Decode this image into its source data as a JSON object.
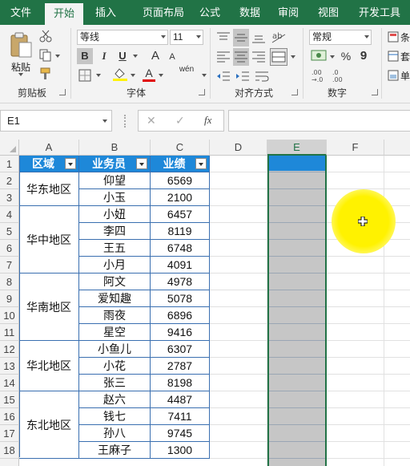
{
  "ribbon_tabs": [
    "文件",
    "开始",
    "插入",
    "页面布局",
    "公式",
    "数据",
    "审阅",
    "视图",
    "开发工具"
  ],
  "ribbon": {
    "paste_label": "粘贴",
    "font_name": "等线",
    "font_size": "11",
    "bold": "B",
    "italic": "I",
    "underline": "U",
    "grow_font": "A",
    "shrink_font": "A",
    "font_color": "A",
    "phonetic": "wén",
    "number_format": "常规",
    "percent": "%",
    "comma": "9",
    "dec_inc": ".00\n→.0",
    "dec_dec": ".00\n→.0",
    "right_partial": [
      "条",
      "套",
      "单"
    ],
    "groups": [
      "剪贴板",
      "字体",
      "对齐方式",
      "数字"
    ]
  },
  "formula_bar": {
    "name_box": "E1",
    "fx": "fx",
    "cancel": "✕",
    "enter": "✓",
    "formula": ""
  },
  "columns": [
    "A",
    "B",
    "C",
    "D",
    "E",
    "F"
  ],
  "rows": [
    "1",
    "2",
    "3",
    "4",
    "5",
    "6",
    "7",
    "8",
    "9",
    "10",
    "11",
    "12",
    "13",
    "14",
    "15",
    "16",
    "17",
    "18"
  ],
  "table": {
    "headers": [
      "区域",
      "业务员",
      "业绩"
    ],
    "regions": [
      "华东地区",
      "华中地区",
      "华南地区",
      "华北地区",
      "东北地区"
    ],
    "people": [
      "仰望",
      "小玉",
      "小妞",
      "李四",
      "王五",
      "小月",
      "阿文",
      "爱知趣",
      "雨夜",
      "星空",
      "小鱼儿",
      "小花",
      "张三",
      "赵六",
      "钱七",
      "孙八",
      "王麻子"
    ],
    "sales": [
      "6569",
      "2100",
      "6457",
      "8119",
      "6748",
      "4091",
      "4978",
      "5078",
      "6896",
      "9416",
      "6307",
      "2787",
      "8198",
      "4487",
      "7411",
      "9745",
      "1300"
    ]
  },
  "colors": {
    "accent": "#217346",
    "header_fill": "#1e88d9",
    "selection_fill": "#c6c6c6",
    "cursor_highlight": "#fff200"
  }
}
